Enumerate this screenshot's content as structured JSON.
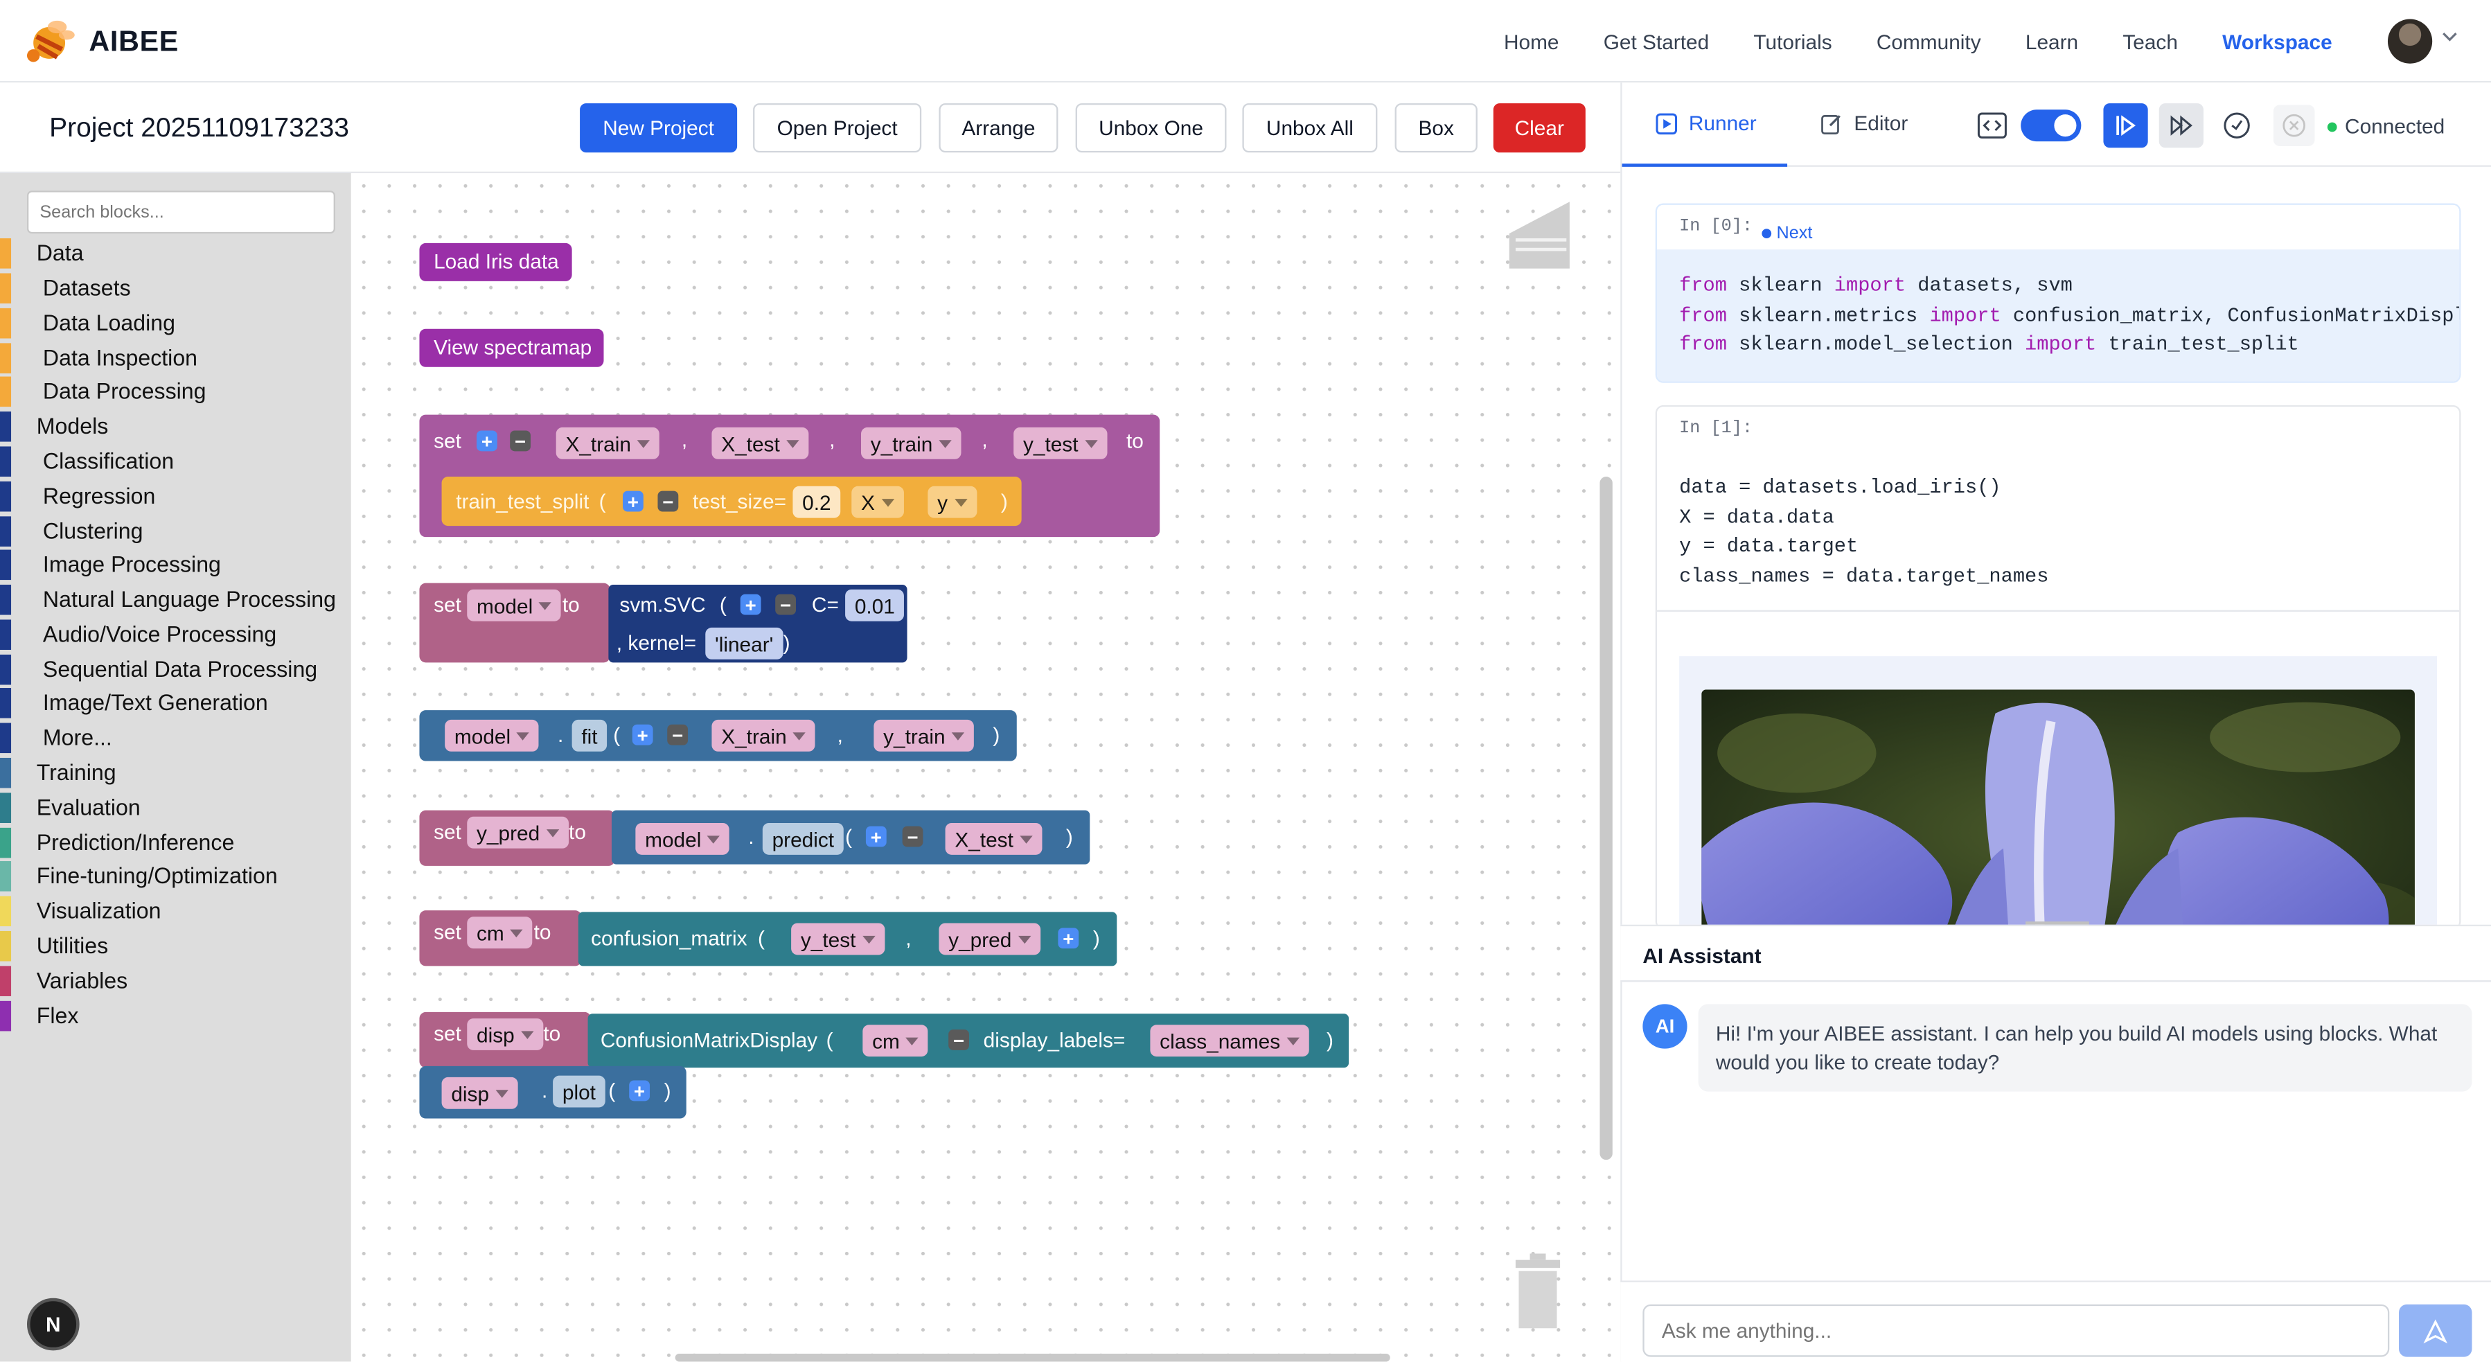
{
  "nav": {
    "brand": "AIBEE",
    "links": [
      "Home",
      "Get Started",
      "Tutorials",
      "Community",
      "Learn",
      "Teach",
      "Workspace"
    ],
    "active": "Workspace"
  },
  "project": {
    "title": "Project 20251109173233",
    "buttons": {
      "new_project": "New Project",
      "open_project": "Open Project",
      "arrange": "Arrange",
      "unbox_one": "Unbox One",
      "unbox_all": "Unbox All",
      "box": "Box",
      "clear": "Clear"
    }
  },
  "sidebar": {
    "search_placeholder": "Search blocks...",
    "categories": [
      {
        "label": "Data",
        "color": "#f4a93a",
        "indent": false
      },
      {
        "label": "Datasets",
        "color": "#f4a93a",
        "indent": true
      },
      {
        "label": "Data Loading",
        "color": "#f4a93a",
        "indent": true
      },
      {
        "label": "Data Inspection",
        "color": "#f4a93a",
        "indent": true
      },
      {
        "label": "Data Processing",
        "color": "#f4a93a",
        "indent": true
      },
      {
        "label": "Models",
        "color": "#1e3a8a",
        "indent": false
      },
      {
        "label": "Classification",
        "color": "#1e3a8a",
        "indent": true
      },
      {
        "label": "Regression",
        "color": "#1e3a8a",
        "indent": true
      },
      {
        "label": "Clustering",
        "color": "#1e3a8a",
        "indent": true
      },
      {
        "label": "Image Processing",
        "color": "#1e3a8a",
        "indent": true
      },
      {
        "label": "Natural Language Processing",
        "color": "#1e3a8a",
        "indent": true
      },
      {
        "label": "Audio/Voice Processing",
        "color": "#1e3a8a",
        "indent": true
      },
      {
        "label": "Sequential Data Processing",
        "color": "#1e3a8a",
        "indent": true
      },
      {
        "label": "Image/Text Generation",
        "color": "#1e3a8a",
        "indent": true
      },
      {
        "label": "More...",
        "color": "#1e3a8a",
        "indent": true
      },
      {
        "label": "Training",
        "color": "#3b6f9e",
        "indent": false
      },
      {
        "label": "Evaluation",
        "color": "#2e7d8c",
        "indent": false
      },
      {
        "label": "Prediction/Inference",
        "color": "#3aa38a",
        "indent": false
      },
      {
        "label": "Fine-tuning/Optimization",
        "color": "#6ab7a8",
        "indent": false
      },
      {
        "label": "Visualization",
        "color": "#f0d85a",
        "indent": false
      },
      {
        "label": "Utilities",
        "color": "#e8c94a",
        "indent": false
      },
      {
        "label": "Variables",
        "color": "#c0406a",
        "indent": false
      },
      {
        "label": "Flex",
        "color": "#8e2fb0",
        "indent": false
      }
    ],
    "badge": "N"
  },
  "blocks": {
    "load_iris": "Load Iris data",
    "view_spectramap": "View spectramap",
    "set": "set",
    "to": "to",
    "comma": ",",
    "lparen": "(",
    "rparen": ")",
    "dot": ".",
    "split_vars": [
      "X_train",
      "X_test",
      "y_train",
      "y_test"
    ],
    "train_test_split": "train_test_split",
    "test_size_label": "test_size=",
    "test_size_value": "0.2",
    "X": "X",
    "y": "y",
    "model": "model",
    "svm_svc": "svm.SVC",
    "c_label": "C=",
    "c_value": "0.01",
    "kernel_label": ", kernel=",
    "kernel_value": "'linear'",
    "fit": "fit",
    "x_train": "X_train",
    "y_train": "y_train",
    "y_pred": "y_pred",
    "predict": "predict",
    "x_test": "X_test",
    "cm": "cm",
    "confusion_matrix": "confusion_matrix",
    "y_test": "y_test",
    "disp": "disp",
    "cmd": "ConfusionMatrixDisplay",
    "display_labels": "display_labels=",
    "class_names": "class_names",
    "plot": "plot"
  },
  "runner": {
    "tab_runner": "Runner",
    "tab_editor": "Editor",
    "status": "Connected",
    "cells": [
      {
        "prompt": "In [0]:",
        "badge": "Next",
        "lines": [
          [
            "from",
            " sklearn ",
            "import",
            " datasets, svm"
          ],
          [
            "from",
            " sklearn.metrics ",
            "import",
            " confusion_matrix, ConfusionMatrixDisplay"
          ],
          [
            "from",
            " sklearn.model_selection ",
            "import",
            " train_test_split"
          ]
        ]
      },
      {
        "prompt": "In [1]:",
        "lines": [
          "data = datasets.load_iris()",
          "X = data.data",
          "y = data.target",
          "class_names = data.target_names"
        ]
      }
    ]
  },
  "assistant": {
    "title": "AI Assistant",
    "avatar": "AI",
    "message": "Hi! I'm your AIBEE assistant. I can help you build AI models using blocks. What would you like to create today?",
    "input_placeholder": "Ask me anything..."
  }
}
